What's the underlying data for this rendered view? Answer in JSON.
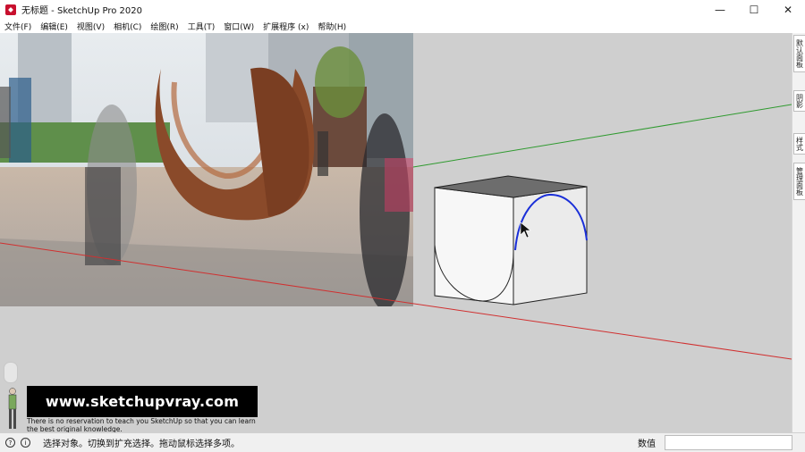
{
  "window": {
    "title": "无标题 - SketchUp Pro 2020",
    "minimize": "—",
    "maximize": "☐",
    "close": "✕"
  },
  "menu": [
    "文件(F)",
    "编辑(E)",
    "视图(V)",
    "相机(C)",
    "绘图(R)",
    "工具(T)",
    "窗口(W)",
    "扩展程序 (x)",
    "帮助(H)"
  ],
  "tray": {
    "tabs": [
      "默认面板",
      "阴影",
      "样式",
      "管理面板"
    ]
  },
  "watermark": {
    "url": "www.sketchupvray.com",
    "tagline_line1": "There is no reservation to teach you SketchUp so that you can learn",
    "tagline_line2": "the best original knowledge."
  },
  "status": {
    "message": "选择对象。切换到扩充选择。拖动鼠标选择多项。",
    "measure_label": "数值",
    "measure_value": ""
  },
  "colors": {
    "viewport": "#cfcfcf",
    "red_axis": "#d03030",
    "green_axis": "#2f9a2f",
    "blue_arc": "#1a2fd8"
  }
}
